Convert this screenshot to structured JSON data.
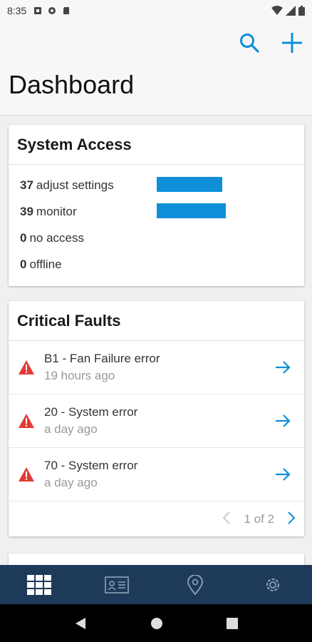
{
  "status_bar": {
    "time": "8:35"
  },
  "header": {
    "title": "Dashboard",
    "search_icon": "search-icon",
    "add_icon": "plus-icon"
  },
  "system_access": {
    "title": "System Access",
    "rows": [
      {
        "count": "37",
        "label": "adjust settings",
        "fraction": 0.95
      },
      {
        "count": "39",
        "label": "monitor",
        "fraction": 1.0
      },
      {
        "count": "0",
        "label": "no access",
        "fraction": 0
      },
      {
        "count": "0",
        "label": "offline",
        "fraction": 0
      }
    ]
  },
  "critical_faults": {
    "title": "Critical Faults",
    "items": [
      {
        "title": "B1 - Fan Failure error",
        "time": "19 hours ago"
      },
      {
        "title": "20 - System error",
        "time": "a day ago"
      },
      {
        "title": "70 - System error",
        "time": "a day ago"
      }
    ],
    "pager": "1 of 2"
  },
  "bottom_nav": [
    "dashboard-grid-icon",
    "contacts-card-icon",
    "location-pin-icon",
    "settings-gear-icon"
  ],
  "colors": {
    "accent": "#0e8fd8",
    "nav_bg": "#1e3a5a",
    "warning": "#e53935"
  }
}
